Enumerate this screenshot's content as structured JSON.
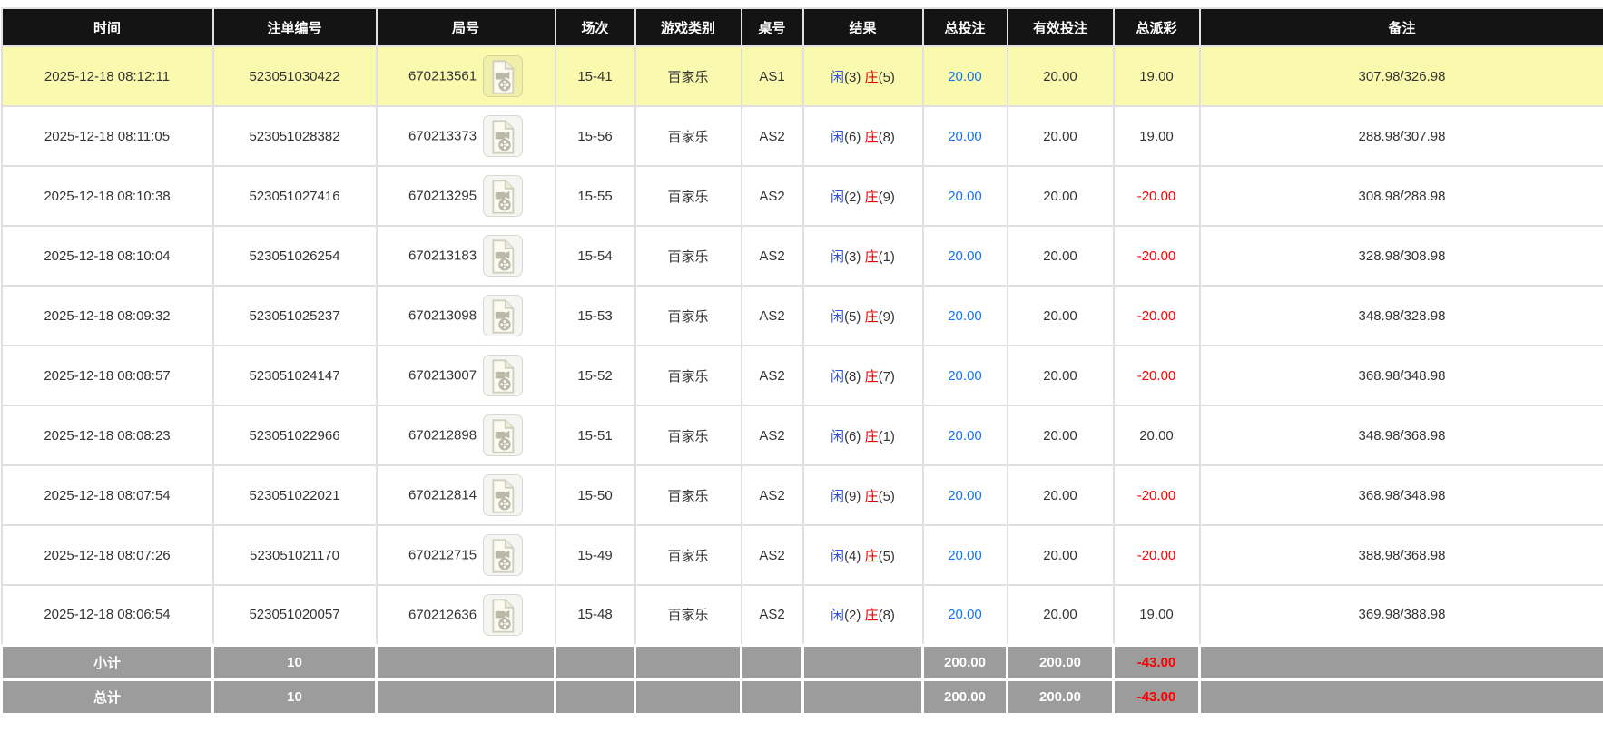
{
  "colors": {
    "header_bg": "#141414",
    "header_text": "#ffffff",
    "highlight_row_bg": "#fafaae",
    "row_bg": "#ffffff",
    "summary_bg": "#9c9c9c",
    "summary_text": "#ffffff",
    "negative_red": "#ff0000",
    "bet_amount_blue": "#1673f5",
    "player_blue": "#3050e0",
    "banker_red": "#e00000"
  },
  "table": {
    "columns": [
      {
        "id": "time",
        "label": "时间"
      },
      {
        "id": "bet_id",
        "label": "注单编号"
      },
      {
        "id": "round_id",
        "label": "局号"
      },
      {
        "id": "session",
        "label": "场次"
      },
      {
        "id": "game_type",
        "label": "游戏类别"
      },
      {
        "id": "table_no",
        "label": "桌号"
      },
      {
        "id": "result",
        "label": "结果"
      },
      {
        "id": "total_bet",
        "label": "总投注"
      },
      {
        "id": "valid_bet",
        "label": "有效投注"
      },
      {
        "id": "payout",
        "label": "总派彩"
      },
      {
        "id": "remark",
        "label": "备注"
      }
    ],
    "result_format": {
      "player_label": "闲",
      "banker_label": "庄"
    },
    "video_icon": {
      "name": "video-replay-icon"
    },
    "rows": [
      {
        "highlighted": true,
        "time": "2025-12-18 08:12:11",
        "bet_id": "523051030422",
        "round_id": "670213561",
        "session": "15-41",
        "game_type": "百家乐",
        "table_no": "AS1",
        "result": {
          "player_score": "(3)",
          "banker_score": "(5)"
        },
        "total_bet": "20.00",
        "valid_bet": "20.00",
        "payout": "19.00",
        "remark": "307.98/326.98"
      },
      {
        "highlighted": false,
        "time": "2025-12-18 08:11:05",
        "bet_id": "523051028382",
        "round_id": "670213373",
        "session": "15-56",
        "game_type": "百家乐",
        "table_no": "AS2",
        "result": {
          "player_score": "(6)",
          "banker_score": "(8)"
        },
        "total_bet": "20.00",
        "valid_bet": "20.00",
        "payout": "19.00",
        "remark": "288.98/307.98"
      },
      {
        "highlighted": false,
        "time": "2025-12-18 08:10:38",
        "bet_id": "523051027416",
        "round_id": "670213295",
        "session": "15-55",
        "game_type": "百家乐",
        "table_no": "AS2",
        "result": {
          "player_score": "(2)",
          "banker_score": "(9)"
        },
        "total_bet": "20.00",
        "valid_bet": "20.00",
        "payout": "-20.00",
        "remark": "308.98/288.98"
      },
      {
        "highlighted": false,
        "time": "2025-12-18 08:10:04",
        "bet_id": "523051026254",
        "round_id": "670213183",
        "session": "15-54",
        "game_type": "百家乐",
        "table_no": "AS2",
        "result": {
          "player_score": "(3)",
          "banker_score": "(1)"
        },
        "total_bet": "20.00",
        "valid_bet": "20.00",
        "payout": "-20.00",
        "remark": "328.98/308.98"
      },
      {
        "highlighted": false,
        "time": "2025-12-18 08:09:32",
        "bet_id": "523051025237",
        "round_id": "670213098",
        "session": "15-53",
        "game_type": "百家乐",
        "table_no": "AS2",
        "result": {
          "player_score": "(5)",
          "banker_score": "(9)"
        },
        "total_bet": "20.00",
        "valid_bet": "20.00",
        "payout": "-20.00",
        "remark": "348.98/328.98"
      },
      {
        "highlighted": false,
        "time": "2025-12-18 08:08:57",
        "bet_id": "523051024147",
        "round_id": "670213007",
        "session": "15-52",
        "game_type": "百家乐",
        "table_no": "AS2",
        "result": {
          "player_score": "(8)",
          "banker_score": "(7)"
        },
        "total_bet": "20.00",
        "valid_bet": "20.00",
        "payout": "-20.00",
        "remark": "368.98/348.98"
      },
      {
        "highlighted": false,
        "time": "2025-12-18 08:08:23",
        "bet_id": "523051022966",
        "round_id": "670212898",
        "session": "15-51",
        "game_type": "百家乐",
        "table_no": "AS2",
        "result": {
          "player_score": "(6)",
          "banker_score": "(1)"
        },
        "total_bet": "20.00",
        "valid_bet": "20.00",
        "payout": "20.00",
        "remark": "348.98/368.98"
      },
      {
        "highlighted": false,
        "time": "2025-12-18 08:07:54",
        "bet_id": "523051022021",
        "round_id": "670212814",
        "session": "15-50",
        "game_type": "百家乐",
        "table_no": "AS2",
        "result": {
          "player_score": "(9)",
          "banker_score": "(5)"
        },
        "total_bet": "20.00",
        "valid_bet": "20.00",
        "payout": "-20.00",
        "remark": "368.98/348.98"
      },
      {
        "highlighted": false,
        "time": "2025-12-18 08:07:26",
        "bet_id": "523051021170",
        "round_id": "670212715",
        "session": "15-49",
        "game_type": "百家乐",
        "table_no": "AS2",
        "result": {
          "player_score": "(4)",
          "banker_score": "(5)"
        },
        "total_bet": "20.00",
        "valid_bet": "20.00",
        "payout": "-20.00",
        "remark": "388.98/368.98"
      },
      {
        "highlighted": false,
        "time": "2025-12-18 08:06:54",
        "bet_id": "523051020057",
        "round_id": "670212636",
        "session": "15-48",
        "game_type": "百家乐",
        "table_no": "AS2",
        "result": {
          "player_score": "(2)",
          "banker_score": "(8)"
        },
        "total_bet": "20.00",
        "valid_bet": "20.00",
        "payout": "19.00",
        "remark": "369.98/388.98"
      }
    ],
    "summary_rows": [
      {
        "label": "小计",
        "count": "10",
        "total_bet": "200.00",
        "valid_bet": "200.00",
        "payout": "-43.00",
        "remark": ""
      },
      {
        "label": "总计",
        "count": "10",
        "total_bet": "200.00",
        "valid_bet": "200.00",
        "payout": "-43.00",
        "remark": ""
      }
    ]
  }
}
